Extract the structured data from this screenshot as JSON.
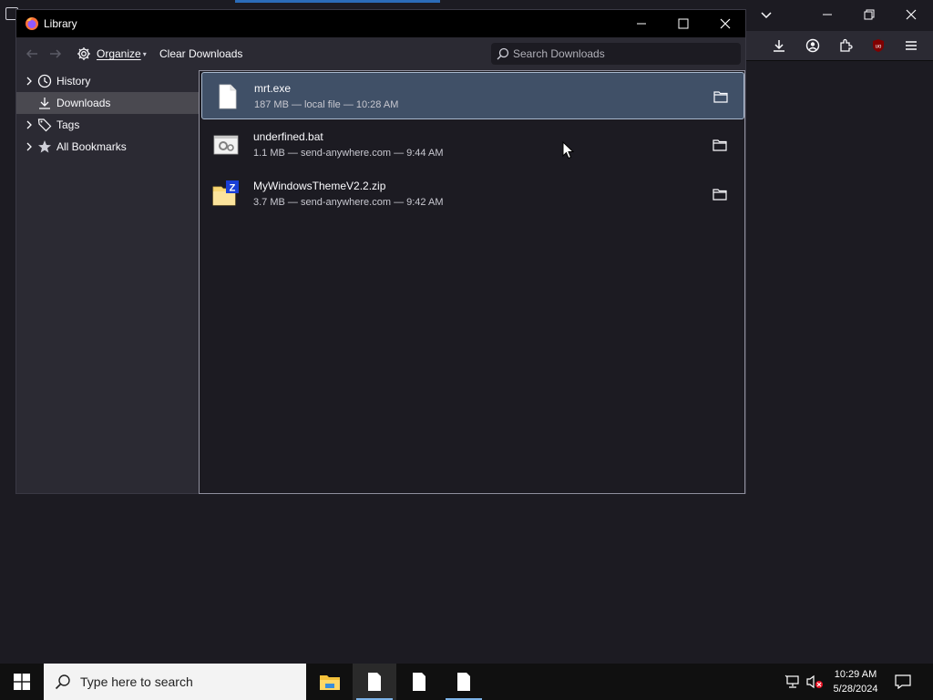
{
  "window": {
    "title": "Library"
  },
  "toolbar": {
    "organize_label": "Organize",
    "clear_label": "Clear Downloads",
    "search_placeholder": "Search Downloads"
  },
  "sidebar": {
    "items": [
      {
        "label": "History",
        "icon": "clock-icon",
        "expandable": true,
        "selected": false
      },
      {
        "label": "Downloads",
        "icon": "download-icon",
        "expandable": false,
        "selected": true
      },
      {
        "label": "Tags",
        "icon": "tag-icon",
        "expandable": true,
        "selected": false
      },
      {
        "label": "All Bookmarks",
        "icon": "star-icon",
        "expandable": true,
        "selected": false
      }
    ]
  },
  "downloads": [
    {
      "name": "mrt.exe",
      "meta": "187 MB — local file — 10:28 AM",
      "icon": "exe-file-icon",
      "selected": true
    },
    {
      "name": "underfined.bat",
      "meta": "1.1 MB — send-anywhere.com — 9:44 AM",
      "icon": "bat-file-icon",
      "selected": false
    },
    {
      "name": "MyWindowsThemeV2.2.zip",
      "meta": "3.7 MB — send-anywhere.com — 9:42 AM",
      "icon": "zip-file-icon",
      "selected": false
    }
  ],
  "taskbar": {
    "search_placeholder": "Type here to search",
    "time": "10:29 AM",
    "date": "5/28/2024"
  },
  "colors": {
    "selected_row": "#405067",
    "sidebar_bg": "#2b2a33",
    "window_bg": "#1c1b22"
  }
}
